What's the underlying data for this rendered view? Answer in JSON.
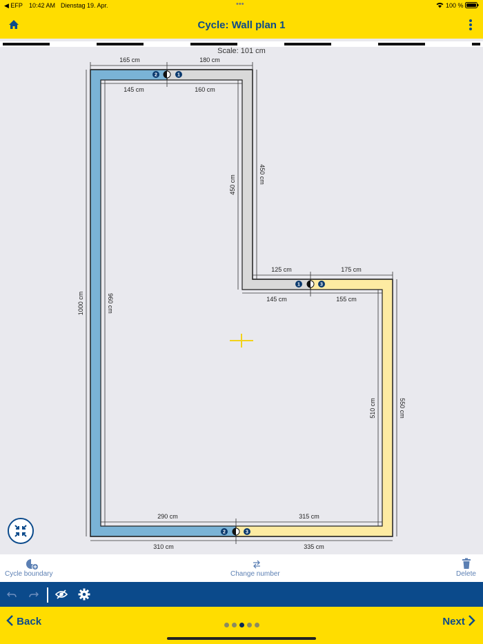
{
  "status": {
    "carrier": "◀ EFP",
    "time": "10:42 AM",
    "date": "Dienstag 19. Apr.",
    "battery": "100 %"
  },
  "header": {
    "title": "Cycle: Wall plan 1"
  },
  "scale": "Scale: 101 cm",
  "plan": {
    "outer_top_left": "165 cm",
    "outer_top_right": "180 cm",
    "inner_top_left": "145 cm",
    "inner_top_right": "160 cm",
    "right_upper_outer": "450 cm",
    "right_upper_inner": "450 cm",
    "mid_outer_left": "125 cm",
    "mid_outer_right": "175 cm",
    "mid_inner_left": "145 cm",
    "mid_inner_right": "155 cm",
    "left_outer": "1000 cm",
    "left_inner": "960 cm",
    "right_lower_inner": "510 cm",
    "right_lower_outer": "550 cm",
    "bottom_inner_left": "290 cm",
    "bottom_inner_right": "315 cm",
    "bottom_outer_left": "310 cm",
    "bottom_outer_right": "335 cm",
    "badges": {
      "one": "1",
      "two": "2",
      "three": "3"
    },
    "colors": {
      "wall1": "#d9d9d9",
      "wall2": "#7ab3d6",
      "wall3": "#fdeba2",
      "accent": "#ffdd00"
    }
  },
  "toolbar": {
    "cycle_boundary": "Cycle boundary",
    "change_number": "Change number",
    "delete": "Delete"
  },
  "nav": {
    "back": "Back",
    "next": "Next"
  }
}
